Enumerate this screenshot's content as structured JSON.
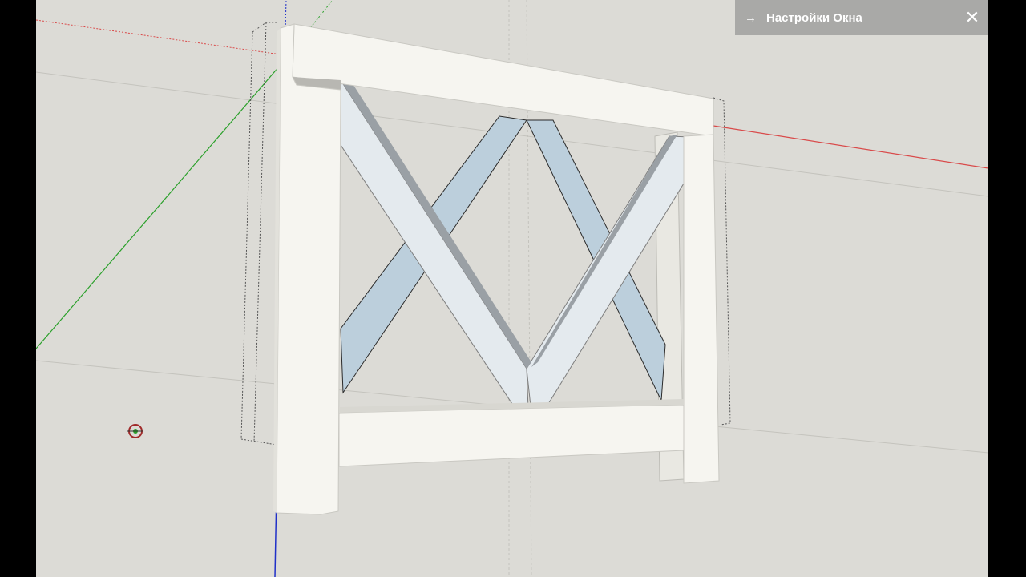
{
  "panel": {
    "title": "Настройки Окна",
    "arrow_icon": "→",
    "close_icon": "✕"
  },
  "colors": {
    "viewport_bg": "#dcdbd6",
    "model_face": "#f6f5f0",
    "glass": "#bccfdc",
    "axis_red": "#d94a4a",
    "axis_green": "#2aa02a",
    "axis_blue": "#2030c8",
    "panel_bg": "#a9a9a7"
  }
}
